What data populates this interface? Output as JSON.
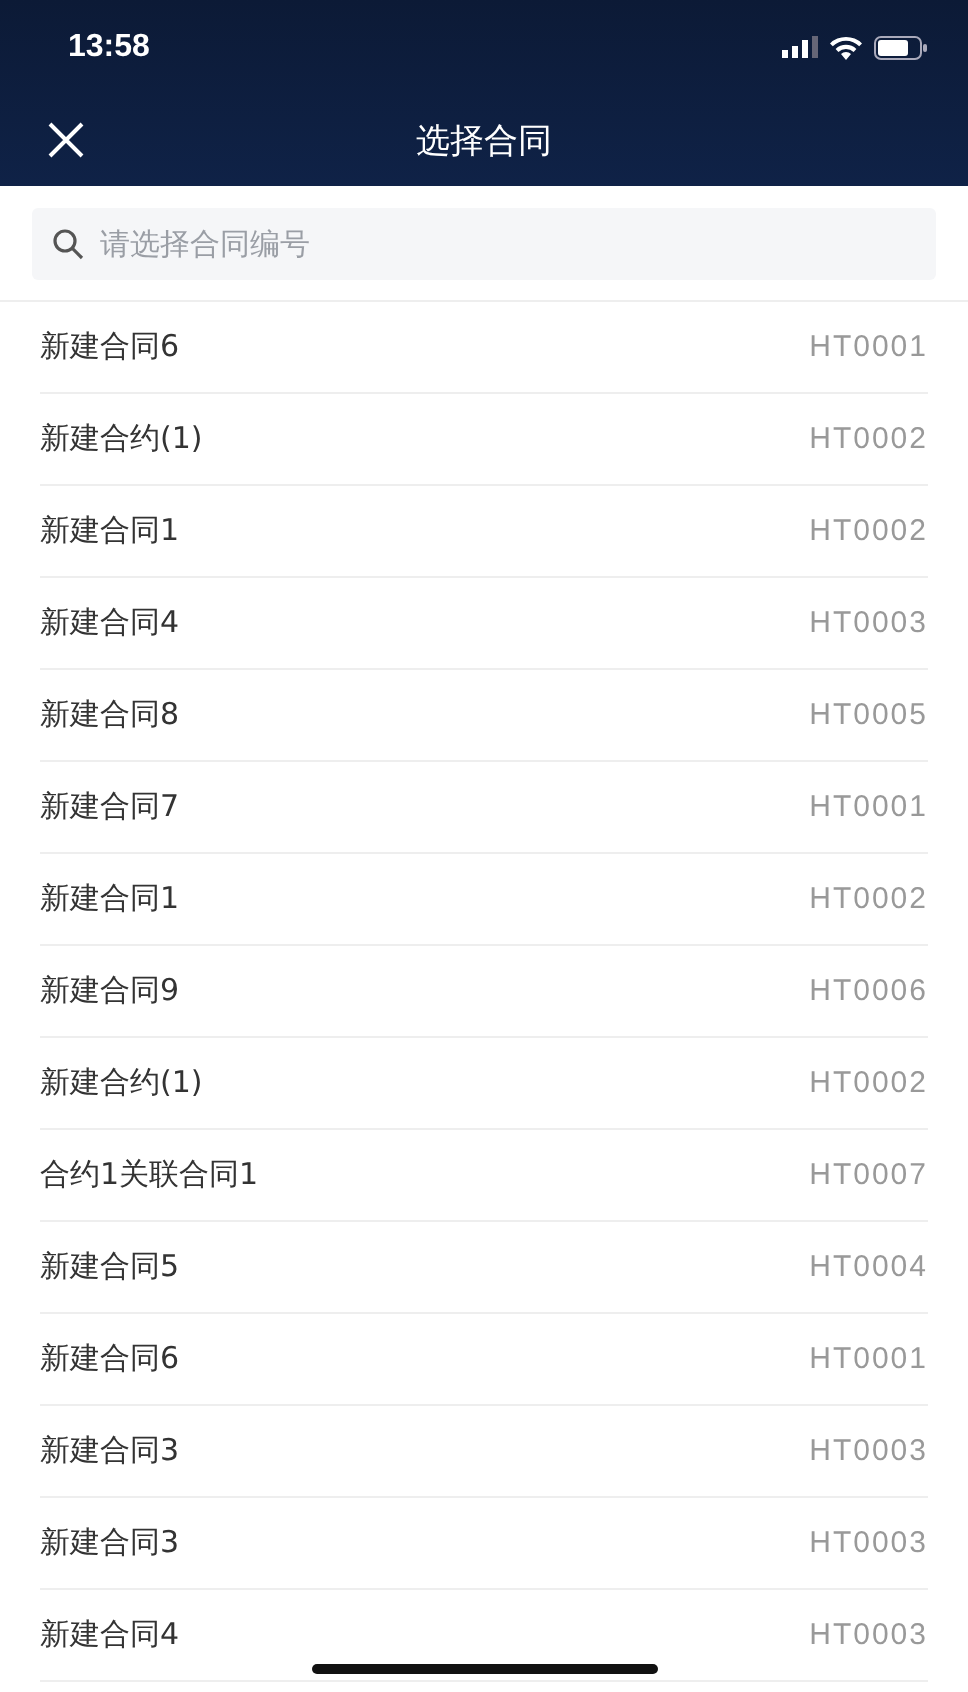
{
  "status_bar": {
    "time": "13:58"
  },
  "nav": {
    "title": "选择合同"
  },
  "search": {
    "placeholder": "请选择合同编号"
  },
  "contracts": [
    {
      "name": "新建合同6",
      "code": "HT0001"
    },
    {
      "name": "新建合约(1)",
      "code": "HT0002"
    },
    {
      "name": "新建合同1",
      "code": "HT0002"
    },
    {
      "name": "新建合同4",
      "code": "HT0003"
    },
    {
      "name": "新建合同8",
      "code": "HT0005"
    },
    {
      "name": "新建合同7",
      "code": "HT0001"
    },
    {
      "name": "新建合同1",
      "code": "HT0002"
    },
    {
      "name": "新建合同9",
      "code": "HT0006"
    },
    {
      "name": "新建合约(1)",
      "code": "HT0002"
    },
    {
      "name": "合约1关联合同1",
      "code": "HT0007"
    },
    {
      "name": "新建合同5",
      "code": "HT0004"
    },
    {
      "name": "新建合同6",
      "code": "HT0001"
    },
    {
      "name": "新建合同3",
      "code": "HT0003"
    },
    {
      "name": "新建合同3",
      "code": "HT0003"
    },
    {
      "name": "新建合同4",
      "code": "HT0003"
    }
  ]
}
